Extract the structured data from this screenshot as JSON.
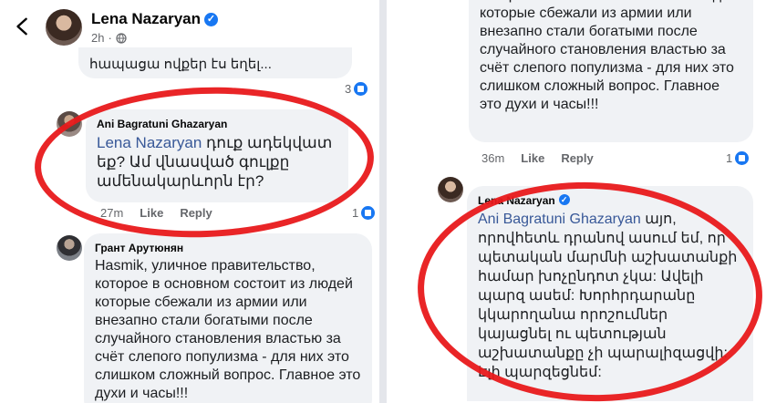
{
  "left": {
    "header": {
      "name": "Lena Nazaryan",
      "meta": "2h"
    },
    "prev_comment": {
      "tail_text": "հապաց­ա ովքեր էս եղել...",
      "reaction_count": "3"
    },
    "ani_comment": {
      "author": "Ani Bagratuni Ghazaryan",
      "mention": "Lena Nazaryan",
      "text_after_mention": " դուք ադեկվատ եք? Ամ վնասված գուլքը ամենակարևորն էր?",
      "time": "27m",
      "like": "Like",
      "reply": "Reply",
      "reaction_count": "1"
    },
    "grant_comment": {
      "author": "Грант Арутюнян",
      "text": "Hasmik, уличное правительство, которое в основном состоит из людей которые сбежали из армии или внезапно стали богатыми после случайного становления властью за счёт слепого популизма - для них это слишком сложный вопрос. Главное это духи и часы!!!"
    }
  },
  "right": {
    "top_comment": {
      "text": "Hasmik, уличное правительство, которое в основном состоит из людей которые сбежали из армии или внезапно стали богатыми после случайного становления властью за счёт слепого популизма - для них это слишком сложный вопрос. Главное это духи и часы!!!",
      "time": "36m",
      "like": "Like",
      "reply": "Reply",
      "reaction_count": "1"
    },
    "lena_reply": {
      "author": "Lena Nazaryan",
      "mention": "Ani Bagratuni Ghazaryan",
      "text_after_mention": " այո, որովհետև դրանով ասում եմ, որ պետական մարմնի աշխատանքի համար խոչընդոտ չկա: Ավելի պարզ ասեմ: Խորհրդարանը կկարողանա որոշումներ կայացնել ու պետության աշխատանքը չի պարալիզացվի: Էլի պարզեցնեմ:"
    }
  },
  "colors": {
    "annotation_circle": "#e8191b",
    "mention": "#385898",
    "verified": "#1877f2"
  }
}
